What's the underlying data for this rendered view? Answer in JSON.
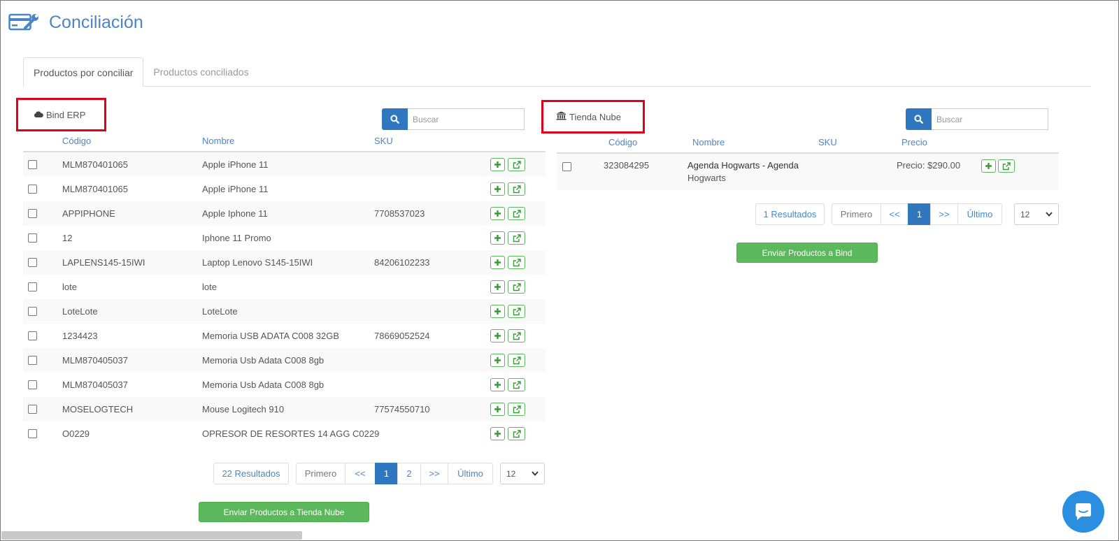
{
  "page": {
    "title": "Conciliación"
  },
  "tabs": [
    {
      "label": "Productos por conciliar",
      "active": true
    },
    {
      "label": "Productos conciliados",
      "active": false
    }
  ],
  "left": {
    "label": "Bind ERP",
    "label_icon": "cloud-icon",
    "search_placeholder": "Buscar",
    "columns": [
      "Código",
      "Nombre",
      "SKU"
    ],
    "rows": [
      {
        "codigo": "MLM870401065",
        "nombre": "Apple iPhone 11",
        "sku": ""
      },
      {
        "codigo": "MLM870401065",
        "nombre": "Apple iPhone 11",
        "sku": ""
      },
      {
        "codigo": "APPIPHONE",
        "nombre": "Apple Iphone 11",
        "sku": "7708537023"
      },
      {
        "codigo": "12",
        "nombre": "Iphone 11 Promo",
        "sku": ""
      },
      {
        "codigo": "LAPLENS145-15IWI",
        "nombre": "Laptop Lenovo S145-15IWI",
        "sku": "84206102233"
      },
      {
        "codigo": "lote",
        "nombre": "lote",
        "sku": ""
      },
      {
        "codigo": "LoteLote",
        "nombre": "LoteLote",
        "sku": ""
      },
      {
        "codigo": "1234423",
        "nombre": "Memoria USB ADATA C008 32GB",
        "sku": "78669052524"
      },
      {
        "codigo": "MLM870405037",
        "nombre": "Memoria Usb Adata C008 8gb",
        "sku": ""
      },
      {
        "codigo": "MLM870405037",
        "nombre": "Memoria Usb Adata C008 8gb",
        "sku": ""
      },
      {
        "codigo": "MOSELOGTECH",
        "nombre": "Mouse Logitech 910",
        "sku": "77574550710"
      },
      {
        "codigo": "O0229",
        "nombre": "OPRESOR DE RESORTES 14 AGG C0229",
        "sku": ""
      }
    ],
    "results": "22 Resultados",
    "pager": {
      "first": "Primero",
      "prev": "<<",
      "pages": [
        "1",
        "2"
      ],
      "current": "1",
      "next": ">>",
      "last": "Último"
    },
    "page_size": "12",
    "send_button": "Enviar Productos a Tienda Nube"
  },
  "right": {
    "label": "Tienda Nube",
    "label_icon": "bank-icon",
    "search_placeholder": "Buscar",
    "columns": [
      "Código",
      "Nombre",
      "SKU",
      "Precio"
    ],
    "rows": [
      {
        "codigo": "323084295",
        "nombre_line1": "Agenda Hogwarts - Agenda",
        "nombre_line2": "Hogwarts",
        "sku": "",
        "precio": "Precio: $290.00"
      }
    ],
    "results": "1 Resultados",
    "pager": {
      "first": "Primero",
      "prev": "<<",
      "pages": [
        "1"
      ],
      "current": "1",
      "next": ">>",
      "last": "Último"
    },
    "page_size": "12",
    "send_button": "Enviar Productos a Bind"
  },
  "colors": {
    "accent": "#2f78c0",
    "link": "#4a86c5",
    "success": "#5cb85c",
    "highlight": "#e0001b",
    "chat": "#2a8fe0"
  },
  "icons": {
    "header": "credit-card-wrench-icon",
    "search": "search-icon",
    "add": "plus-icon",
    "open": "external-link-icon",
    "chat": "chat-bubble-icon",
    "dropdown": "chevron-down-icon"
  }
}
